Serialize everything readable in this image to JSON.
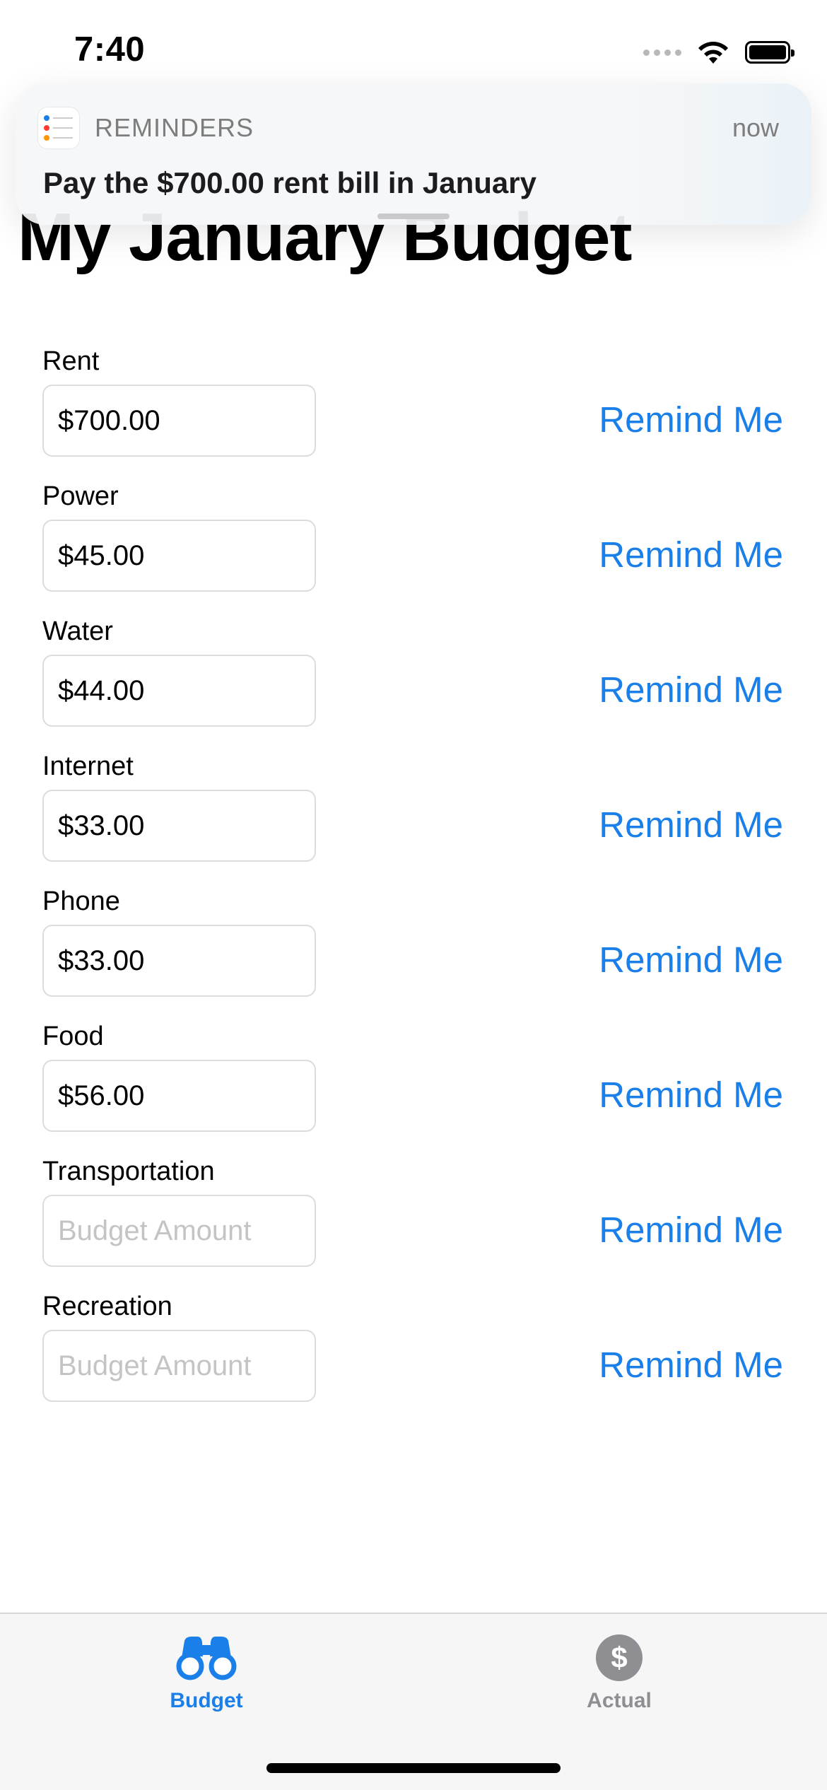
{
  "status_bar": {
    "time": "7:40"
  },
  "notification": {
    "app_name": "REMINDERS",
    "time": "now",
    "message": "Pay the $700.00 rent bill in January"
  },
  "page": {
    "title": "My January Budget"
  },
  "budget_items": [
    {
      "label": "Rent",
      "value": "$700.00",
      "placeholder": "Budget Amount",
      "button": "Remind Me"
    },
    {
      "label": "Power",
      "value": "$45.00",
      "placeholder": "Budget Amount",
      "button": "Remind Me"
    },
    {
      "label": "Water",
      "value": "$44.00",
      "placeholder": "Budget Amount",
      "button": "Remind Me"
    },
    {
      "label": "Internet",
      "value": "$33.00",
      "placeholder": "Budget Amount",
      "button": "Remind Me"
    },
    {
      "label": "Phone",
      "value": "$33.00",
      "placeholder": "Budget Amount",
      "button": "Remind Me"
    },
    {
      "label": "Food",
      "value": "$56.00",
      "placeholder": "Budget Amount",
      "button": "Remind Me"
    },
    {
      "label": "Transportation",
      "value": "",
      "placeholder": "Budget Amount",
      "button": "Remind Me"
    },
    {
      "label": "Recreation",
      "value": "",
      "placeholder": "Budget Amount",
      "button": "Remind Me"
    }
  ],
  "tab_bar": {
    "tabs": [
      {
        "label": "Budget",
        "icon": "binoculars-icon",
        "selected": true
      },
      {
        "label": "Actual",
        "icon": "dollar-circle-icon",
        "selected": false
      }
    ],
    "dollar_symbol": "$"
  },
  "colors": {
    "accent": "#1a7fe8",
    "inactive": "#8e8e93",
    "field_border": "#dcdcdc"
  }
}
